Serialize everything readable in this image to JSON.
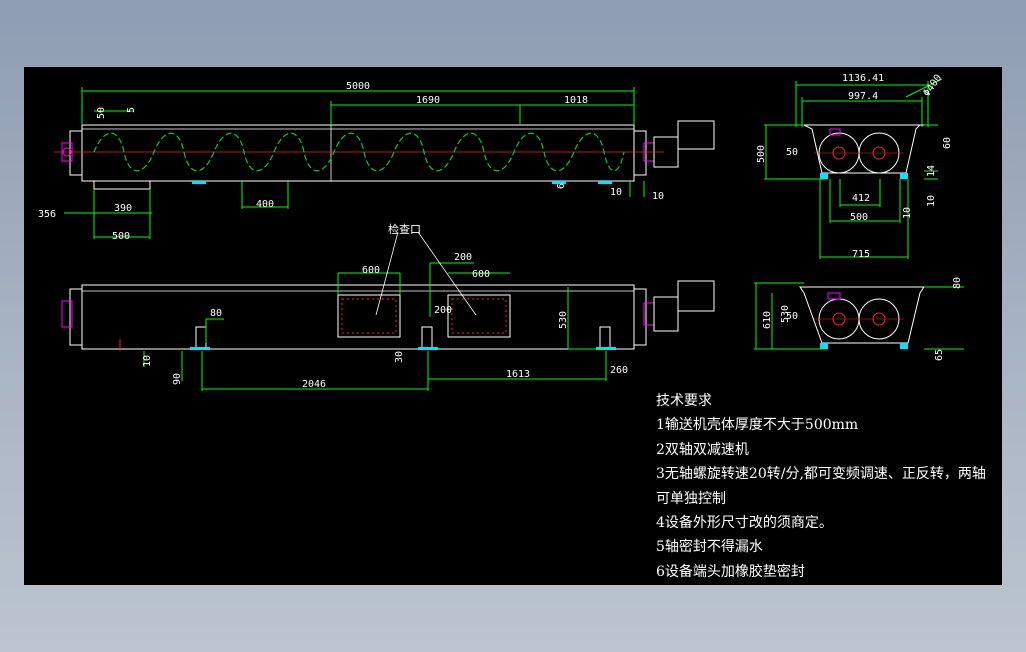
{
  "drawing": {
    "dimensions": {
      "total_length": "5000",
      "d_50": "50",
      "d_5": "5",
      "d_1690": "1690",
      "d_1018": "1018",
      "d_400": "400",
      "d_390": "390",
      "d_356": "356",
      "d_500_left": "500",
      "d_6": "6",
      "d_10a": "10",
      "d_10b": "10",
      "d_600a": "600",
      "d_600b": "600",
      "d_200a": "200",
      "d_200b": "200",
      "d_80": "80",
      "d_530": "530",
      "d_10c": "10",
      "d_90": "90",
      "d_30": "30",
      "d_2046": "2046",
      "d_1613": "1613",
      "d_260": "260",
      "s_1136": "1136.41",
      "s_997": "997.4",
      "s_phi": "Φ400",
      "s_60": "60",
      "s_500v": "500",
      "s_50": "50",
      "s_14": "14",
      "s_412": "412",
      "s_500h": "500",
      "s_10a": "10",
      "s_10b": "10",
      "s_715": "715",
      "b_80": "80",
      "b_610": "610",
      "b_530": "530",
      "b_50": "50",
      "b_65": "65"
    },
    "inspection_label": "检查口"
  },
  "notes": {
    "title": "技术要求",
    "line1": "1输送机壳体厚度不大于500mm",
    "line2": "2双轴双减速机",
    "line3": "3无轴螺旋转速20转/分,都可变频调速、正反转，两轴可单独控制",
    "line4": "4设备外形尺寸改的须商定。",
    "line5": "5轴密封不得漏水",
    "line6": "6设备端头加橡胶垫密封"
  },
  "colors": {
    "background": "#000000",
    "dimension": "#00ff00",
    "body": "#ffffff",
    "spiral": "#00cc33",
    "centerline": "#ff2020",
    "accent": "#ff00ff",
    "cyan": "#00e5ff"
  }
}
